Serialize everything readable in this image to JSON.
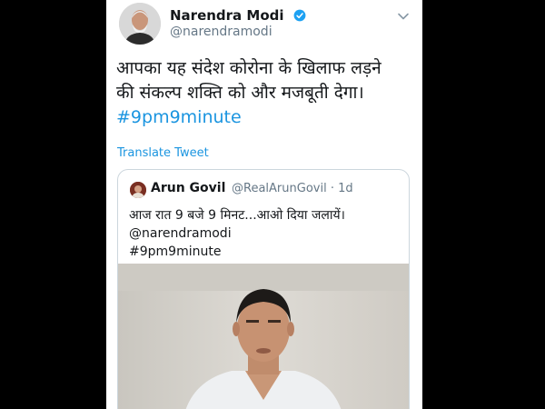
{
  "tweet": {
    "author_name": "Narendra Modi",
    "author_handle": "@narendramodi",
    "text_line1": "आपका यह संदेश कोरोना के खिलाफ लड़ने",
    "text_line2": "की संकल्प शक्ति को और मजबूती देगा।",
    "hashtag": "#9pm9minute",
    "translate_label": "Translate Tweet"
  },
  "quoted": {
    "author_name": "Arun Govil",
    "author_handle": "@RealArunGovil",
    "age": "· 1d",
    "line1": "आज रात 9 बजे 9 मिनट...आओ दिया जलायें।",
    "line2": "@narendramodi",
    "line3": "#9pm9minute"
  },
  "icons": {
    "verified": "verified-badge-icon",
    "caret": "chevron-down-icon"
  },
  "colors": {
    "link": "#1b95e0",
    "verified": "#1da1f2",
    "text": "#14171a",
    "muted": "#657786"
  }
}
